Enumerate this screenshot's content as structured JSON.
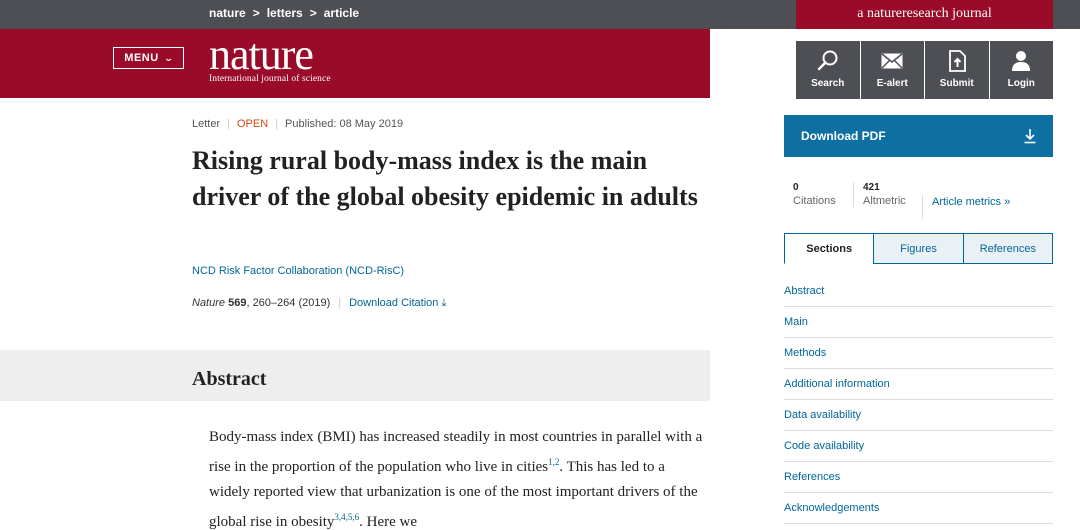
{
  "breadcrumb": [
    "nature",
    "letters",
    "article"
  ],
  "journal_badge": "a natureresearch journal",
  "header": {
    "menu_label": "MENU",
    "logo": "nature",
    "tagline": "International journal of science"
  },
  "tools": [
    {
      "icon": "search-icon",
      "label": "Search"
    },
    {
      "icon": "envelope-icon",
      "label": "E-alert"
    },
    {
      "icon": "upload-document-icon",
      "label": "Submit"
    },
    {
      "icon": "user-icon",
      "label": "Login"
    }
  ],
  "article": {
    "type": "Letter",
    "access": "OPEN",
    "published": "Published: 08 May 2019",
    "title": "Rising rural body-mass index is the main driver of the global obesity epidemic in adults",
    "authors": "NCD Risk Factor Collaboration (NCD-RisC)",
    "journal": "Nature",
    "volume": "569",
    "pages": ", 260–264 (2019)",
    "download_citation": "Download Citation"
  },
  "abstract": {
    "heading": "Abstract",
    "text_1": "Body-mass index (BMI) has increased steadily in most countries in parallel with a rise in the proportion of the population who live in cities",
    "ref_1": "1,2",
    "text_2": ". This has led to a widely reported view that urbanization is one of the most important drivers of the global rise in obesity",
    "ref_2": "3,4,5,6",
    "text_3": ". Here we"
  },
  "sidebar": {
    "download_pdf": "Download PDF",
    "citations_count": "0",
    "citations_label": "Citations",
    "altmetric_count": "421",
    "altmetric_label": "Altmetric",
    "metrics_link": "Article metrics",
    "tabs": [
      "Sections",
      "Figures",
      "References"
    ],
    "active_tab": "Sections",
    "toc": [
      "Abstract",
      "Main",
      "Methods",
      "Additional information",
      "Data availability",
      "Code availability",
      "References",
      "Acknowledgements"
    ]
  },
  "colors": {
    "brand_red": "#990b28",
    "topbar_grey": "#4d4f55",
    "download_blue": "#0d6fa2",
    "link_blue": "#006699",
    "open_orange": "#cc4b15"
  }
}
